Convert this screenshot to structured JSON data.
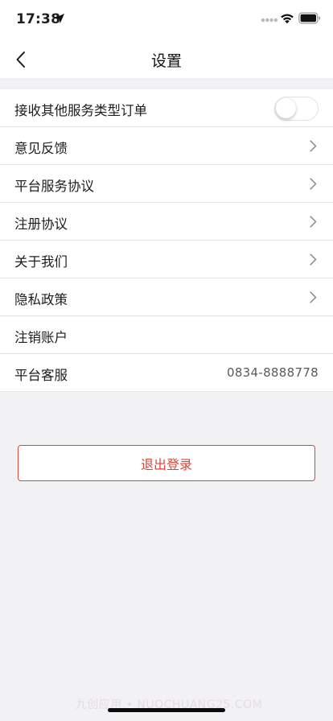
{
  "status_bar": {
    "time": "17:38",
    "icons": [
      "location-arrow-icon",
      "signal-dots-icon",
      "wifi-icon",
      "battery-icon"
    ]
  },
  "nav": {
    "title": "设置",
    "back_icon": "chevron-left-icon"
  },
  "settings": {
    "items": [
      {
        "label": "接收其他服务类型订单",
        "type": "toggle",
        "toggle_on": false
      },
      {
        "label": "意见反馈",
        "type": "link"
      },
      {
        "label": "平台服务协议",
        "type": "link"
      },
      {
        "label": "注册协议",
        "type": "link"
      },
      {
        "label": "关于我们",
        "type": "link"
      },
      {
        "label": "隐私政策",
        "type": "link"
      },
      {
        "label": "注销账户",
        "type": "plain"
      },
      {
        "label": "平台客服",
        "type": "value",
        "value": "0834-8888778"
      }
    ]
  },
  "logout": {
    "label": "退出登录",
    "color": "#d9453b"
  },
  "watermark": {
    "text": "九创应用 • NUOCHUANG25.COM"
  },
  "colors": {
    "background": "#f2f2f4",
    "accent": "#d9453b",
    "row_bg": "#ffffff"
  }
}
